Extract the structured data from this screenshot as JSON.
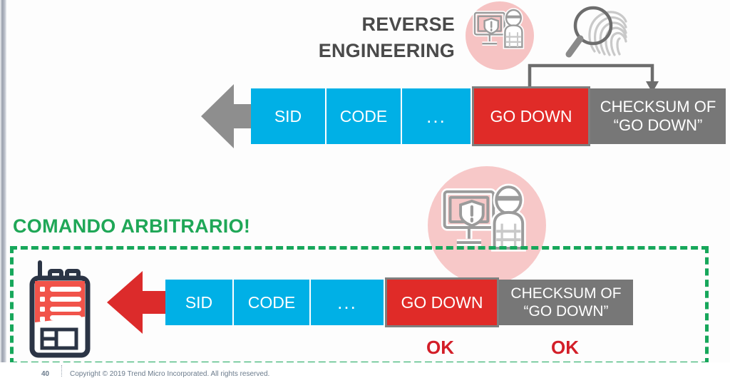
{
  "slide": {
    "title_line1": "REVERSE",
    "title_line2": "ENGINEERING",
    "alert_label": "COMANDO ARBITRARIO!",
    "colors": {
      "blue": "#00b0e6",
      "red": "#e02b28",
      "gray": "#777777",
      "green": "#17a75b",
      "pink": "#f6c3c3",
      "title_gray": "#4a4a4a",
      "ok_red": "#d31e28"
    }
  },
  "top_packet": {
    "arrow_direction": "left",
    "cells": [
      {
        "label": "SID",
        "type": "blue"
      },
      {
        "label": "CODE",
        "type": "blue"
      },
      {
        "label": "...",
        "type": "blue"
      },
      {
        "label": "GO DOWN",
        "type": "red"
      },
      {
        "label": "CHECKSUM OF\n“GO DOWN”",
        "line1": "CHECKSUM OF",
        "line2": "“GO DOWN”",
        "type": "gray"
      }
    ]
  },
  "bottom_packet": {
    "arrow_direction": "left",
    "cells": [
      {
        "label": "SID",
        "type": "blue"
      },
      {
        "label": "CODE",
        "type": "blue"
      },
      {
        "label": "...",
        "type": "blue"
      },
      {
        "label": "GO DOWN",
        "type": "red"
      },
      {
        "label": "CHECKSUM OF\n“GO DOWN”",
        "line1": "CHECKSUM OF",
        "line2": "“GO DOWN”",
        "type": "gray"
      }
    ],
    "status": [
      {
        "label": "OK"
      },
      {
        "label": "OK"
      }
    ]
  },
  "icons": {
    "hacker_top": "hacker-monitor-icon",
    "hacker_mid": "hacker-monitor-icon",
    "magnifier": "magnifier-fingerprint-icon",
    "radio": "walkie-talkie-icon",
    "connector": "checksum-recompute-arrow"
  },
  "footer": {
    "page_number": "40",
    "copyright": "Copyright © 2019 Trend Micro Incorporated. All rights reserved."
  }
}
